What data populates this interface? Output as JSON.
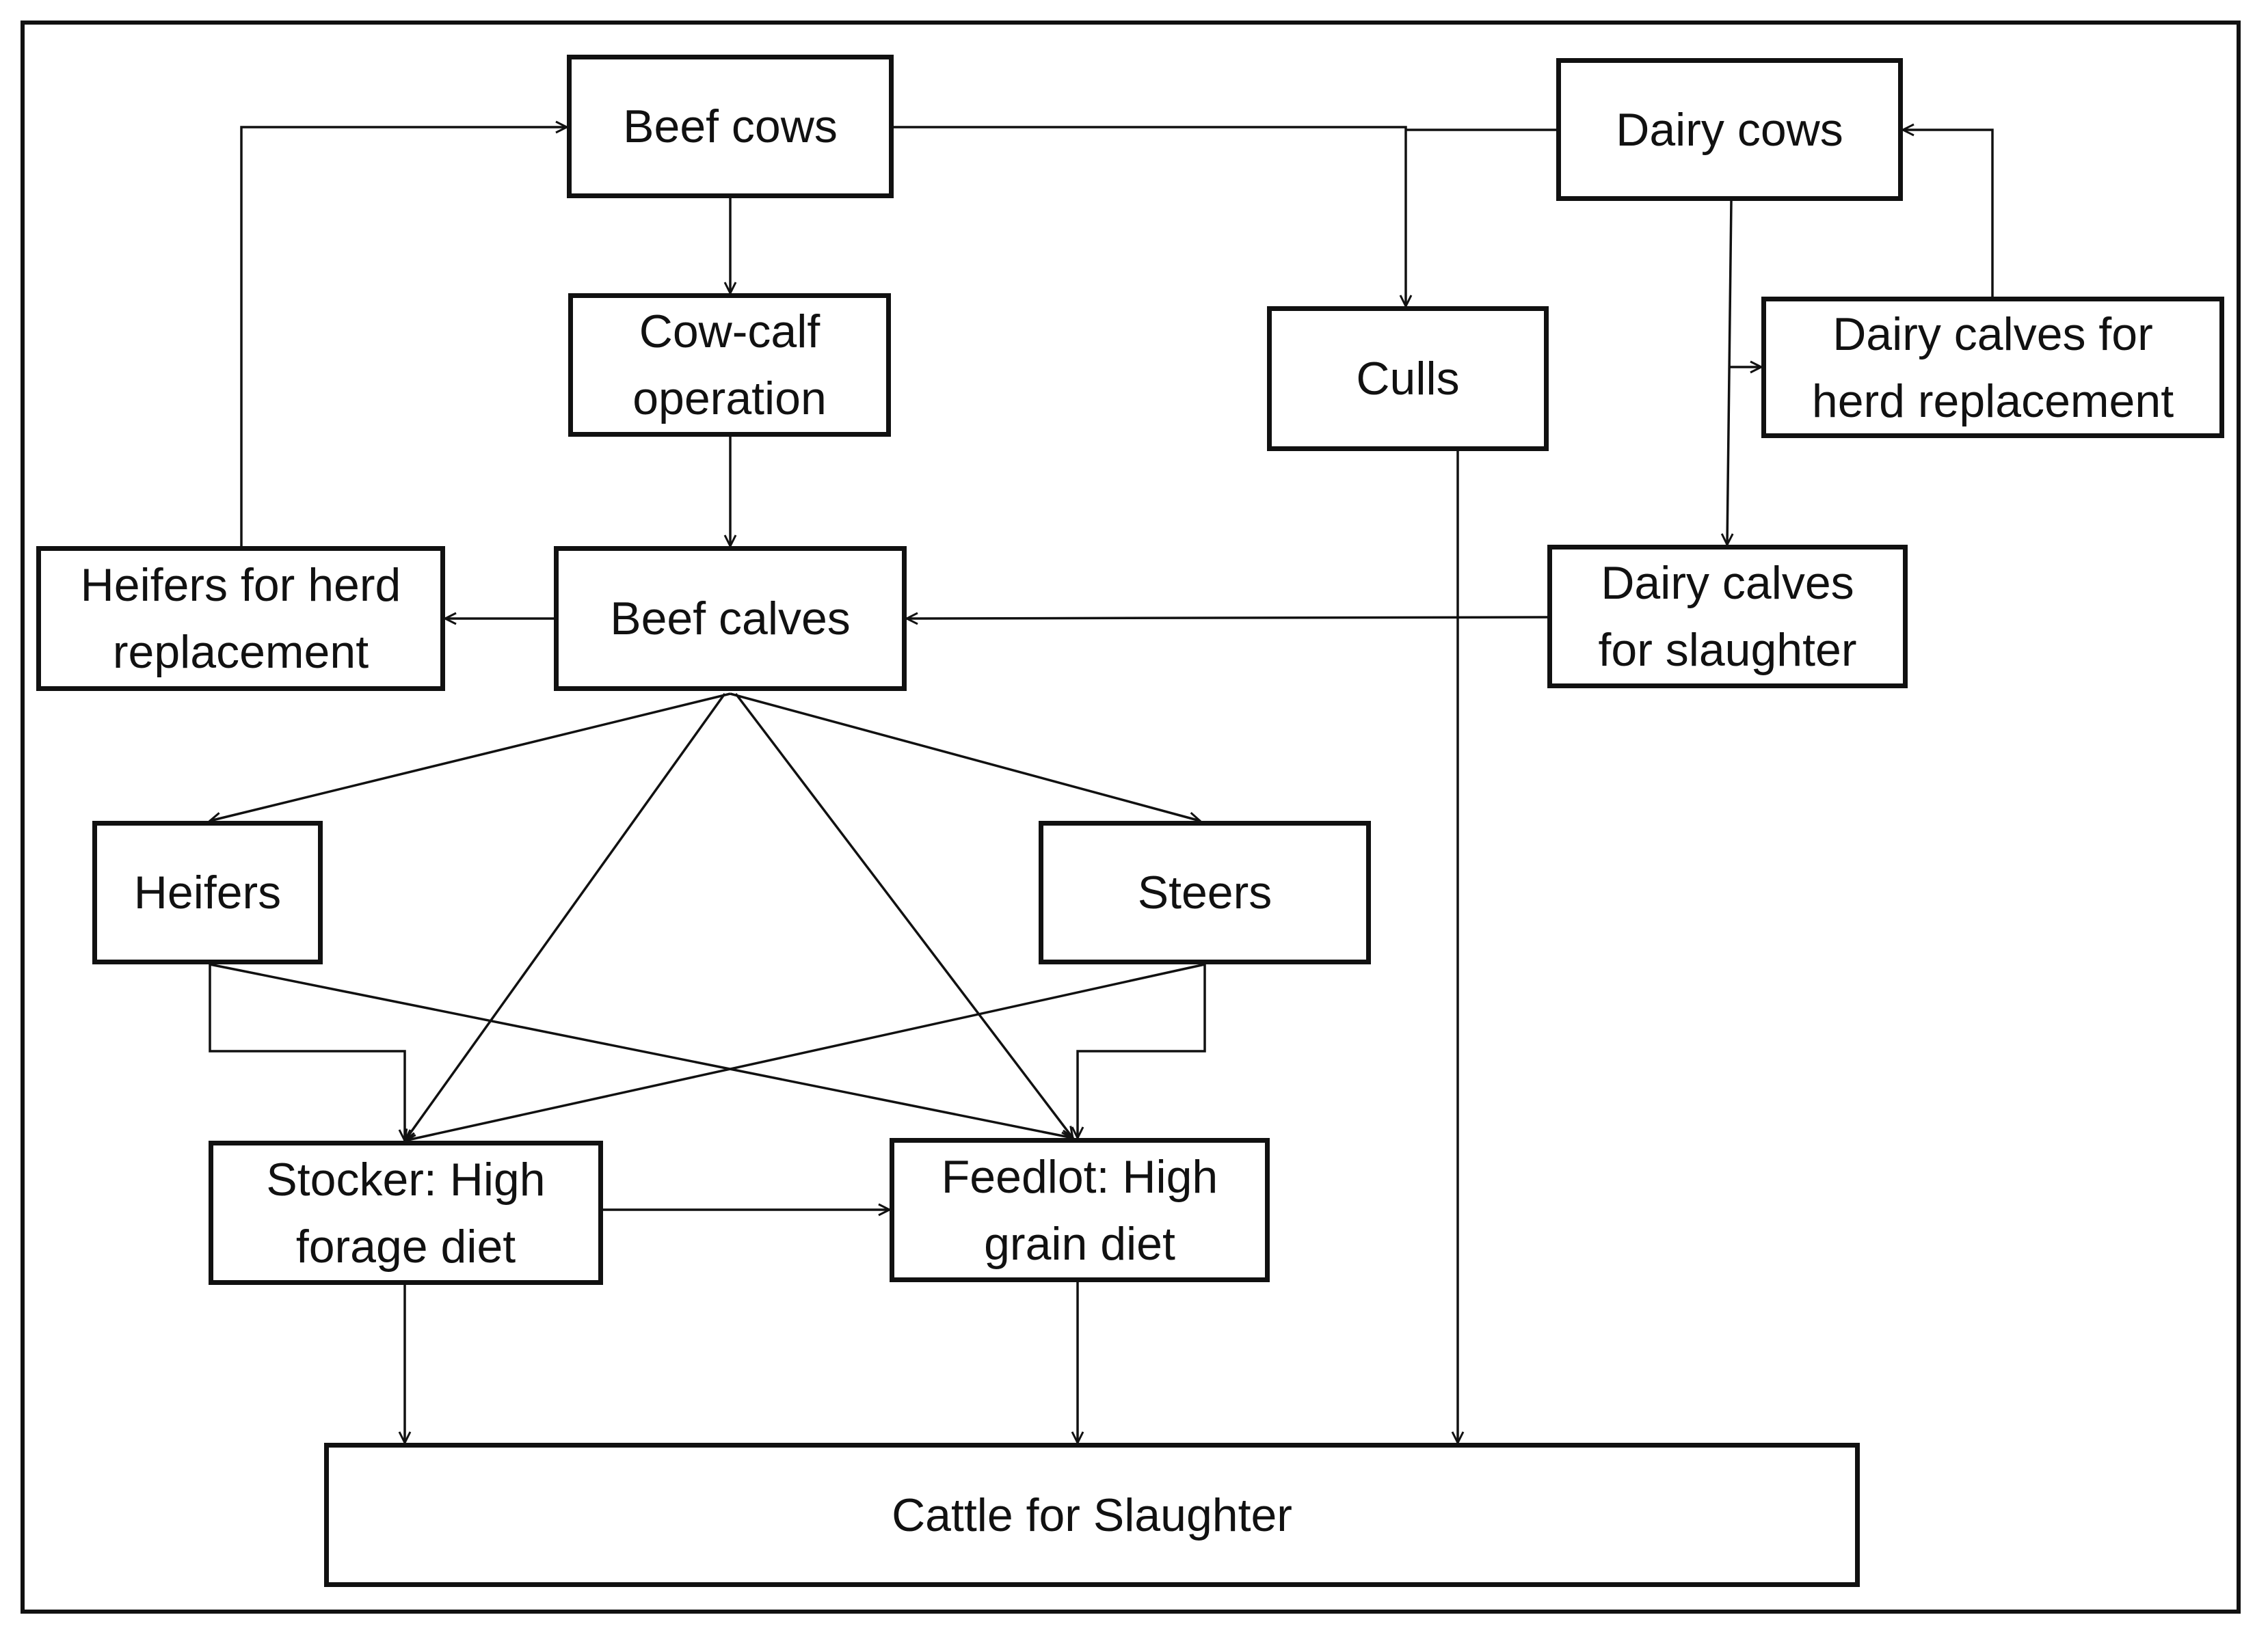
{
  "diagram": {
    "nodes": [
      {
        "id": "beef-cows",
        "label": "Beef cows"
      },
      {
        "id": "dairy-cows",
        "label": "Dairy cows"
      },
      {
        "id": "cow-calf",
        "label": "Cow-calf\noperation"
      },
      {
        "id": "culls",
        "label": "Culls"
      },
      {
        "id": "dairy-calves-herd",
        "label": "Dairy calves for\nherd replacement"
      },
      {
        "id": "heifers-herd",
        "label": "Heifers for herd\nreplacement"
      },
      {
        "id": "beef-calves",
        "label": "Beef calves"
      },
      {
        "id": "dairy-calves-slaughter",
        "label": "Dairy calves\nfor slaughter"
      },
      {
        "id": "heifers",
        "label": "Heifers"
      },
      {
        "id": "steers",
        "label": "Steers"
      },
      {
        "id": "stocker",
        "label": "Stocker: High\nforage diet"
      },
      {
        "id": "feedlot",
        "label": "Feedlot: High\ngrain diet"
      },
      {
        "id": "cattle-slaughter",
        "label": "Cattle for Slaughter"
      }
    ],
    "edges": [
      {
        "from": "beef-cows",
        "to": "cow-calf"
      },
      {
        "from": "cow-calf",
        "to": "beef-calves"
      },
      {
        "from": "beef-cows",
        "to": "culls"
      },
      {
        "from": "dairy-cows",
        "to": "culls"
      },
      {
        "from": "dairy-cows",
        "to": "dairy-calves-herd"
      },
      {
        "from": "dairy-cows",
        "to": "dairy-calves-slaughter"
      },
      {
        "from": "dairy-calves-herd",
        "to": "dairy-cows"
      },
      {
        "from": "heifers-herd",
        "to": "beef-cows"
      },
      {
        "from": "beef-calves",
        "to": "heifers-herd"
      },
      {
        "from": "dairy-calves-slaughter",
        "to": "beef-calves"
      },
      {
        "from": "beef-calves",
        "to": "heifers"
      },
      {
        "from": "beef-calves",
        "to": "steers"
      },
      {
        "from": "beef-calves",
        "to": "stocker"
      },
      {
        "from": "beef-calves",
        "to": "feedlot"
      },
      {
        "from": "heifers",
        "to": "stocker"
      },
      {
        "from": "heifers",
        "to": "feedlot"
      },
      {
        "from": "steers",
        "to": "stocker"
      },
      {
        "from": "steers",
        "to": "feedlot"
      },
      {
        "from": "stocker",
        "to": "feedlot"
      },
      {
        "from": "stocker",
        "to": "cattle-slaughter"
      },
      {
        "from": "feedlot",
        "to": "cattle-slaughter"
      },
      {
        "from": "culls",
        "to": "cattle-slaughter"
      }
    ]
  }
}
